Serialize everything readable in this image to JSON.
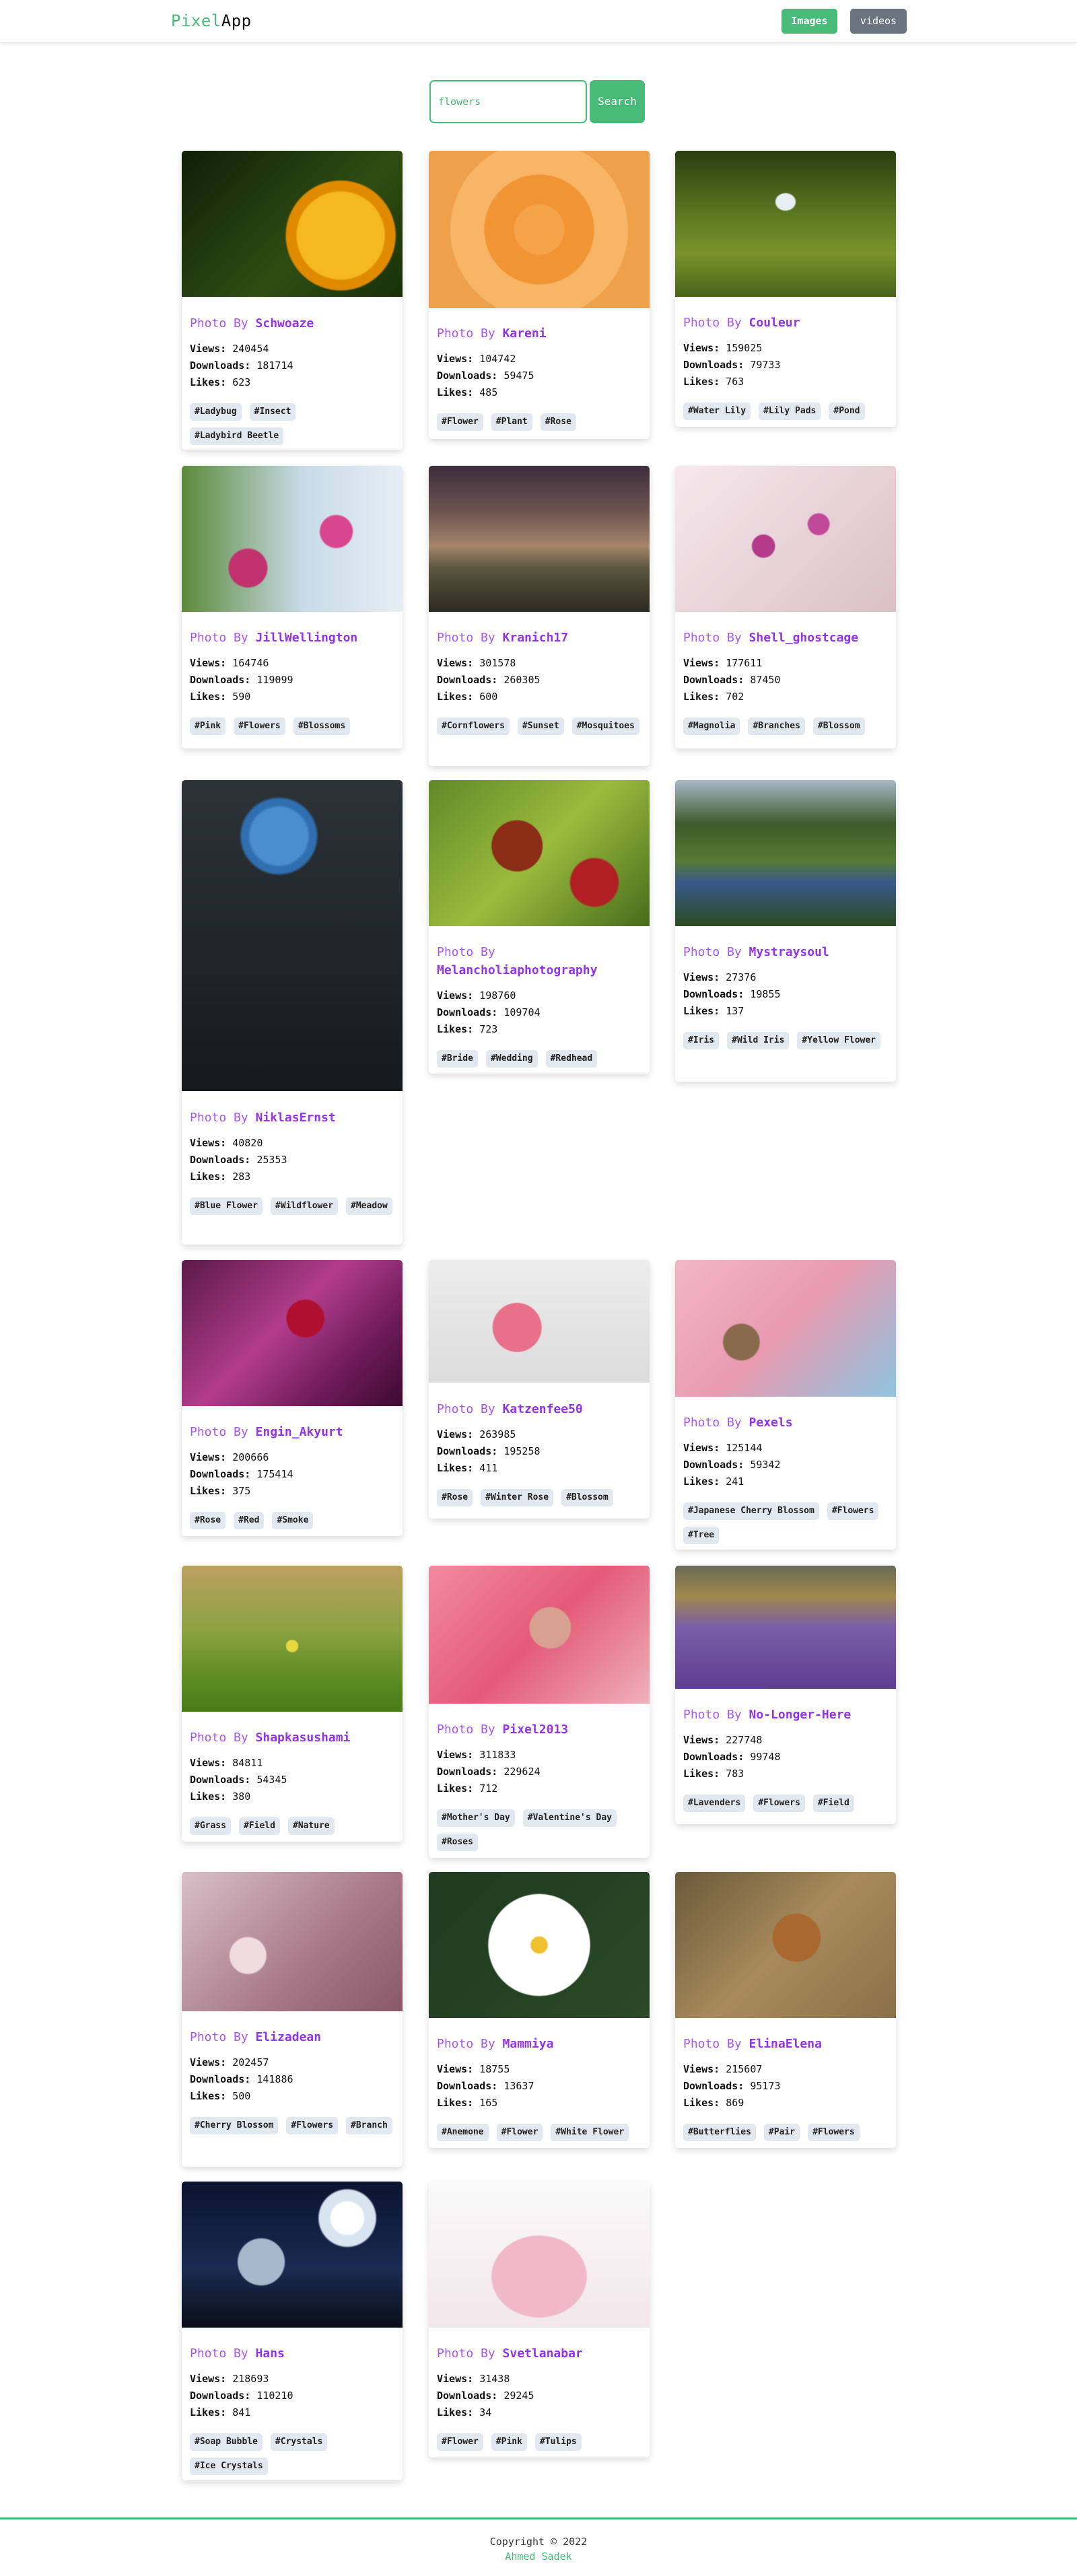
{
  "nav": {
    "brand_part1": "Pixel",
    "brand_part2": "App",
    "images_label": "Images",
    "videos_label": "videos"
  },
  "search": {
    "value": "flowers",
    "button_label": "Search"
  },
  "labels": {
    "photo_by": "Photo By",
    "views": "Views:",
    "downloads": "Downloads:",
    "likes": "Likes:"
  },
  "cards": [
    {
      "author": "Schwoaze",
      "views": "240454",
      "downloads": "181714",
      "likes": "623",
      "tags": [
        "#Ladybug",
        "#Insect",
        "#Ladybird Beetle"
      ]
    },
    {
      "author": "Kareni",
      "views": "104742",
      "downloads": "59475",
      "likes": "485",
      "tags": [
        "#Flower",
        "#Plant",
        "#Rose"
      ]
    },
    {
      "author": "Couleur",
      "views": "159025",
      "downloads": "79733",
      "likes": "763",
      "tags": [
        "#Water Lily",
        "#Lily Pads",
        "#Pond"
      ]
    },
    {
      "author": "JillWellington",
      "views": "164746",
      "downloads": "119099",
      "likes": "590",
      "tags": [
        "#Pink",
        "#Flowers",
        "#Blossoms"
      ]
    },
    {
      "author": "Kranich17",
      "views": "301578",
      "downloads": "260305",
      "likes": "600",
      "tags": [
        "#Cornflowers",
        "#Sunset",
        "#Mosquitoes"
      ]
    },
    {
      "author": "Shell_ghostcage",
      "views": "177611",
      "downloads": "87450",
      "likes": "702",
      "tags": [
        "#Magnolia",
        "#Branches",
        "#Blossom"
      ]
    },
    {
      "author": "NiklasErnst",
      "views": "40820",
      "downloads": "25353",
      "likes": "283",
      "tags": [
        "#Blue Flower",
        "#Wildflower",
        "#Meadow"
      ]
    },
    {
      "author": "Melancholiaphotography",
      "views": "198760",
      "downloads": "109704",
      "likes": "723",
      "tags": [
        "#Bride",
        "#Wedding",
        "#Redhead"
      ]
    },
    {
      "author": "Mystraysoul",
      "views": "27376",
      "downloads": "19855",
      "likes": "137",
      "tags": [
        "#Iris",
        "#Wild Iris",
        "#Yellow Flower"
      ]
    },
    {
      "author": "Engin_Akyurt",
      "views": "200666",
      "downloads": "175414",
      "likes": "375",
      "tags": [
        "#Rose",
        "#Red",
        "#Smoke"
      ]
    },
    {
      "author": "Katzenfee50",
      "views": "263985",
      "downloads": "195258",
      "likes": "411",
      "tags": [
        "#Rose",
        "#Winter Rose",
        "#Blossom"
      ]
    },
    {
      "author": "Pexels",
      "views": "125144",
      "downloads": "59342",
      "likes": "241",
      "tags": [
        "#Japanese Cherry Blossom",
        "#Flowers",
        "#Tree"
      ]
    },
    {
      "author": "Shapkasushami",
      "views": "84811",
      "downloads": "54345",
      "likes": "380",
      "tags": [
        "#Grass",
        "#Field",
        "#Nature"
      ]
    },
    {
      "author": "Pixel2013",
      "views": "311833",
      "downloads": "229624",
      "likes": "712",
      "tags": [
        "#Mother's Day",
        "#Valentine's Day",
        "#Roses"
      ]
    },
    {
      "author": "No-Longer-Here",
      "views": "227748",
      "downloads": "99748",
      "likes": "783",
      "tags": [
        "#Lavenders",
        "#Flowers",
        "#Field"
      ]
    },
    {
      "author": "Elizadean",
      "views": "202457",
      "downloads": "141886",
      "likes": "500",
      "tags": [
        "#Cherry Blossom",
        "#Flowers",
        "#Branch"
      ]
    },
    {
      "author": "Mammiya",
      "views": "18755",
      "downloads": "13637",
      "likes": "165",
      "tags": [
        "#Anemone",
        "#Flower",
        "#White Flower"
      ]
    },
    {
      "author": "ElinaElena",
      "views": "215607",
      "downloads": "95173",
      "likes": "869",
      "tags": [
        "#Butterflies",
        "#Pair",
        "#Flowers"
      ]
    },
    {
      "author": "Hans",
      "views": "218693",
      "downloads": "110210",
      "likes": "841",
      "tags": [
        "#Soap Bubble",
        "#Crystals",
        "#Ice Crystals"
      ]
    },
    {
      "author": "Svetlanabar",
      "views": "31438",
      "downloads": "29245",
      "likes": "34",
      "tags": [
        "#Flower",
        "#Pink",
        "#Tulips"
      ]
    }
  ],
  "footer": {
    "copyright": "Copyright © 2022",
    "author": "Ahmed Sadek"
  },
  "colors": {
    "accent": "#48bb78",
    "author": "#9333ea",
    "tag_bg": "#e2e8f0",
    "videos_btn": "#6b7280"
  }
}
